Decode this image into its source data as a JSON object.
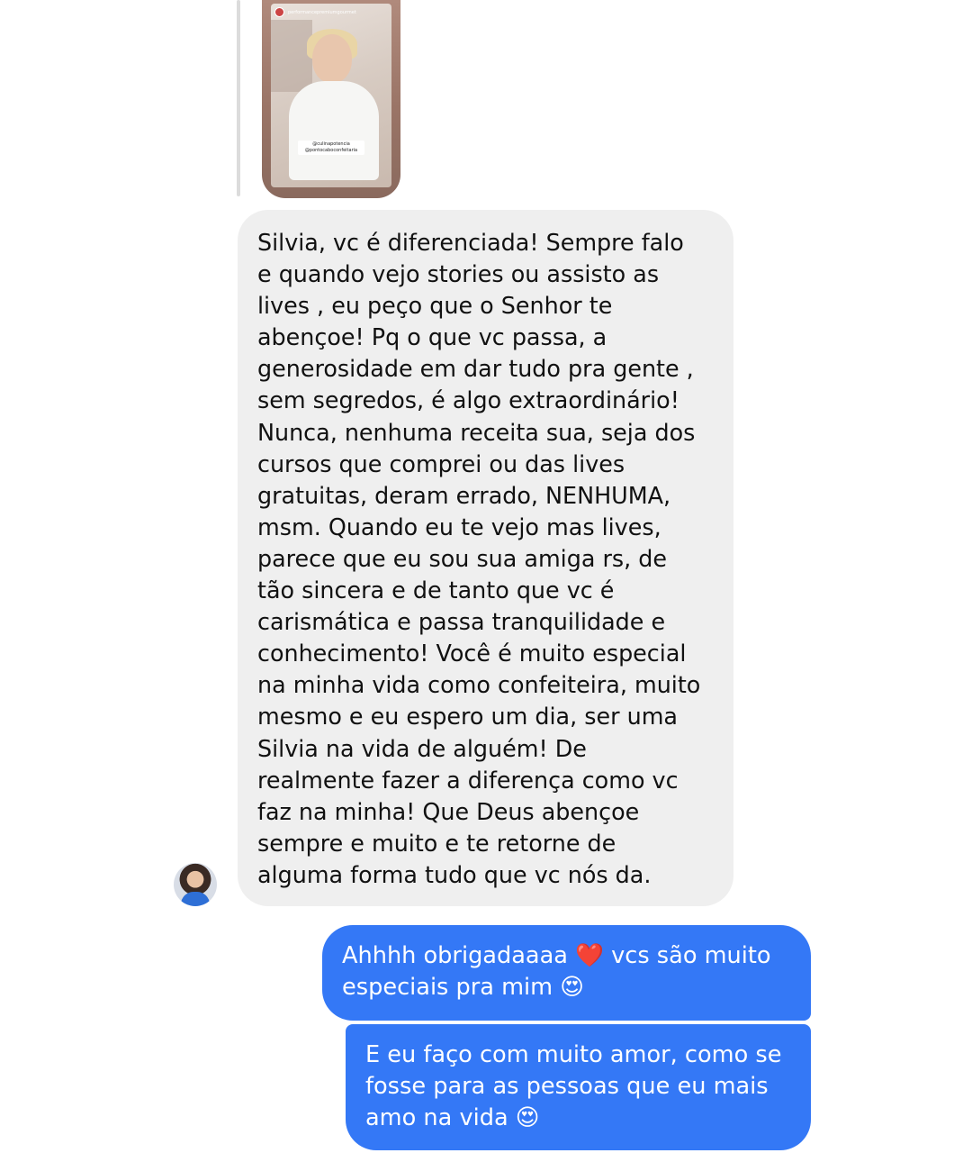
{
  "story_reply": {
    "username": "performancepremiumgourmet",
    "caption_lines": [
      "@culinapotencia",
      "@pontocaboconfeitaria"
    ]
  },
  "messages": {
    "received": {
      "lines": [
        "Silvia, vc é diferenciada! Sempre falo",
        "e quando vejo stories ou assisto as",
        "lives , eu peço que o Senhor te",
        "abençoe! Pq o que vc passa, a",
        "generosidade em dar tudo pra gente ,",
        "sem segredos, é algo extraordinário!",
        "Nunca, nenhuma receita sua, seja dos",
        "cursos que comprei ou das lives",
        "gratuitas, deram errado, NENHUMA,",
        "msm. Quando eu te vejo mas lives,",
        "parece que eu sou sua amiga rs, de",
        "tão sincera e de tanto que vc é",
        "carismática e passa tranquilidade e",
        "conhecimento! Você é muito especial",
        "na minha vida como confeiteira, muito",
        "mesmo e eu espero um dia, ser uma",
        "Silvia na vida de alguém! De",
        "realmente fazer a diferença como vc",
        "faz na minha! Que Deus abençoe",
        "sempre e muito e te retorne de",
        "alguma forma tudo que vc nós da."
      ]
    },
    "sent_1": {
      "lines": [
        "Ahhhh obrigadaaaa ❤️ vcs são muito",
        "especiais pra mim 😍"
      ]
    },
    "sent_2": {
      "lines": [
        "E eu faço com muito amor, como se",
        "fosse para as pessoas que eu mais",
        "amo na vida 😍"
      ]
    }
  },
  "colors": {
    "sent_bubble": "#3478f6",
    "received_bubble": "#efefef",
    "received_text": "#111111",
    "sent_text": "#ffffff"
  }
}
